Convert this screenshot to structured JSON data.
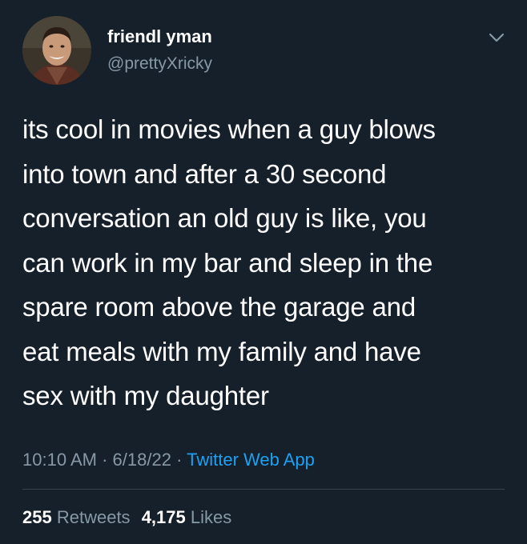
{
  "user": {
    "display_name": "friendl yman",
    "handle": "@prettyXricky"
  },
  "tweet": {
    "lines": [
      "its cool in movies when a guy blows",
      "into town and after a 30 second",
      "conversation an old guy is like, you",
      "can work in my bar and sleep in the",
      "spare room above the garage and",
      "eat meals with my family and have",
      "sex with my daughter"
    ],
    "time": "10:10 AM",
    "date": "6/18/22",
    "separator": "·",
    "source": "Twitter Web App"
  },
  "stats": {
    "retweets_count": "255",
    "retweets_label": "Retweets",
    "likes_count": "4,175",
    "likes_label": "Likes"
  },
  "icons": {
    "menu": "chevron-down-icon"
  },
  "colors": {
    "background": "#15202b",
    "text": "#ffffff",
    "secondary_text": "#8899a6",
    "link": "#1da1f2",
    "divider": "#38444d"
  }
}
